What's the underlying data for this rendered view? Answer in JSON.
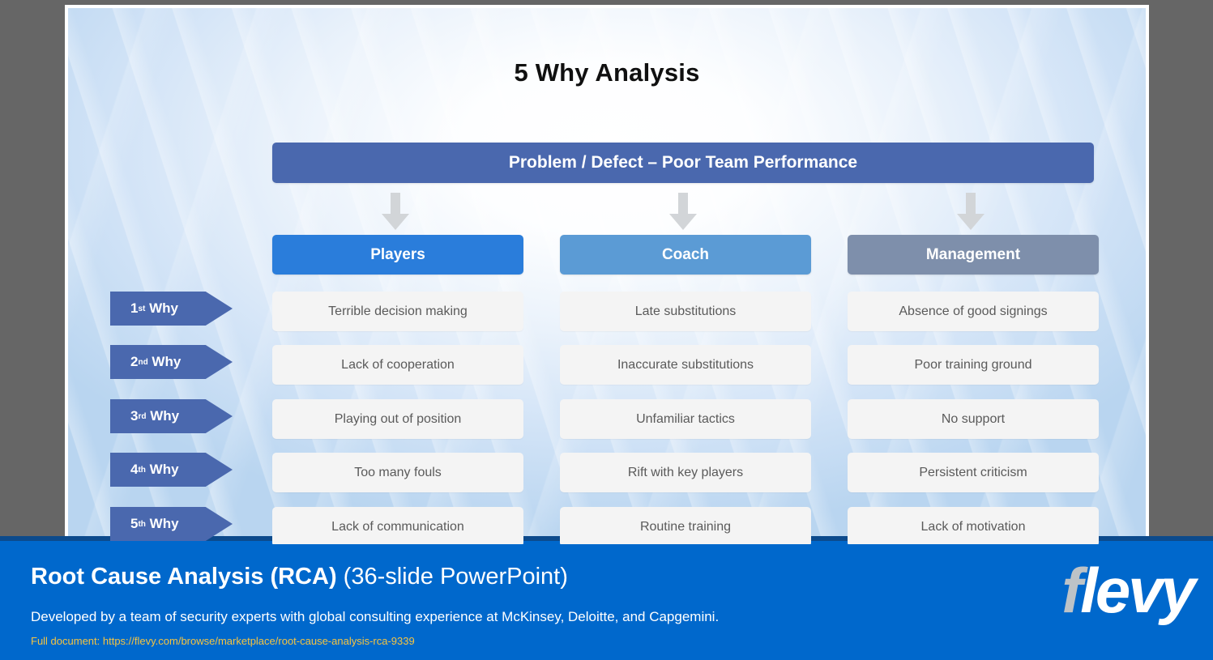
{
  "slide": {
    "title": "5 Why Analysis",
    "problem_bar": "Problem / Defect – Poor Team Performance",
    "columns": [
      {
        "label": "Players",
        "color": "#2a7ddb"
      },
      {
        "label": "Coach",
        "color": "#5b9bd5"
      },
      {
        "label": "Management",
        "color": "#7e8fab"
      }
    ],
    "why_labels": [
      {
        "number": "1",
        "ordinal": "st",
        "word": "Why"
      },
      {
        "number": "2",
        "ordinal": "nd",
        "word": "Why"
      },
      {
        "number": "3",
        "ordinal": "rd",
        "word": "Why"
      },
      {
        "number": "4",
        "ordinal": "th",
        "word": "Why"
      },
      {
        "number": "5",
        "ordinal": "th",
        "word": "Why"
      }
    ],
    "rows": [
      {
        "players": "Terrible decision making",
        "coach": "Late substitutions",
        "management": "Absence of good signings"
      },
      {
        "players": "Lack of cooperation",
        "coach": "Inaccurate substitutions",
        "management": "Poor training ground"
      },
      {
        "players": "Playing out of position",
        "coach": "Unfamiliar tactics",
        "management": "No support"
      },
      {
        "players": "Too many fouls",
        "coach": "Rift with key players",
        "management": "Persistent criticism"
      },
      {
        "players": "Lack of communication",
        "coach": "Routine training",
        "management": "Lack of motivation"
      }
    ],
    "arrow_icon": "arrow-down-icon"
  },
  "banner": {
    "title_strong": "Root Cause Analysis (RCA)",
    "title_light": " (36-slide PowerPoint)",
    "subtitle": "Developed by a team of security experts with global consulting experience at McKinsey, Deloitte, and Capgemini.",
    "url_line": "Full document: https://flevy.com/browse/marketplace/root-cause-analysis-rca-9339",
    "logo_f": "f",
    "logo_rest": "levy",
    "accent_blue": "#0068cc",
    "accent_navy": "#0c4a8c",
    "accent_yellow": "#f5c441"
  }
}
